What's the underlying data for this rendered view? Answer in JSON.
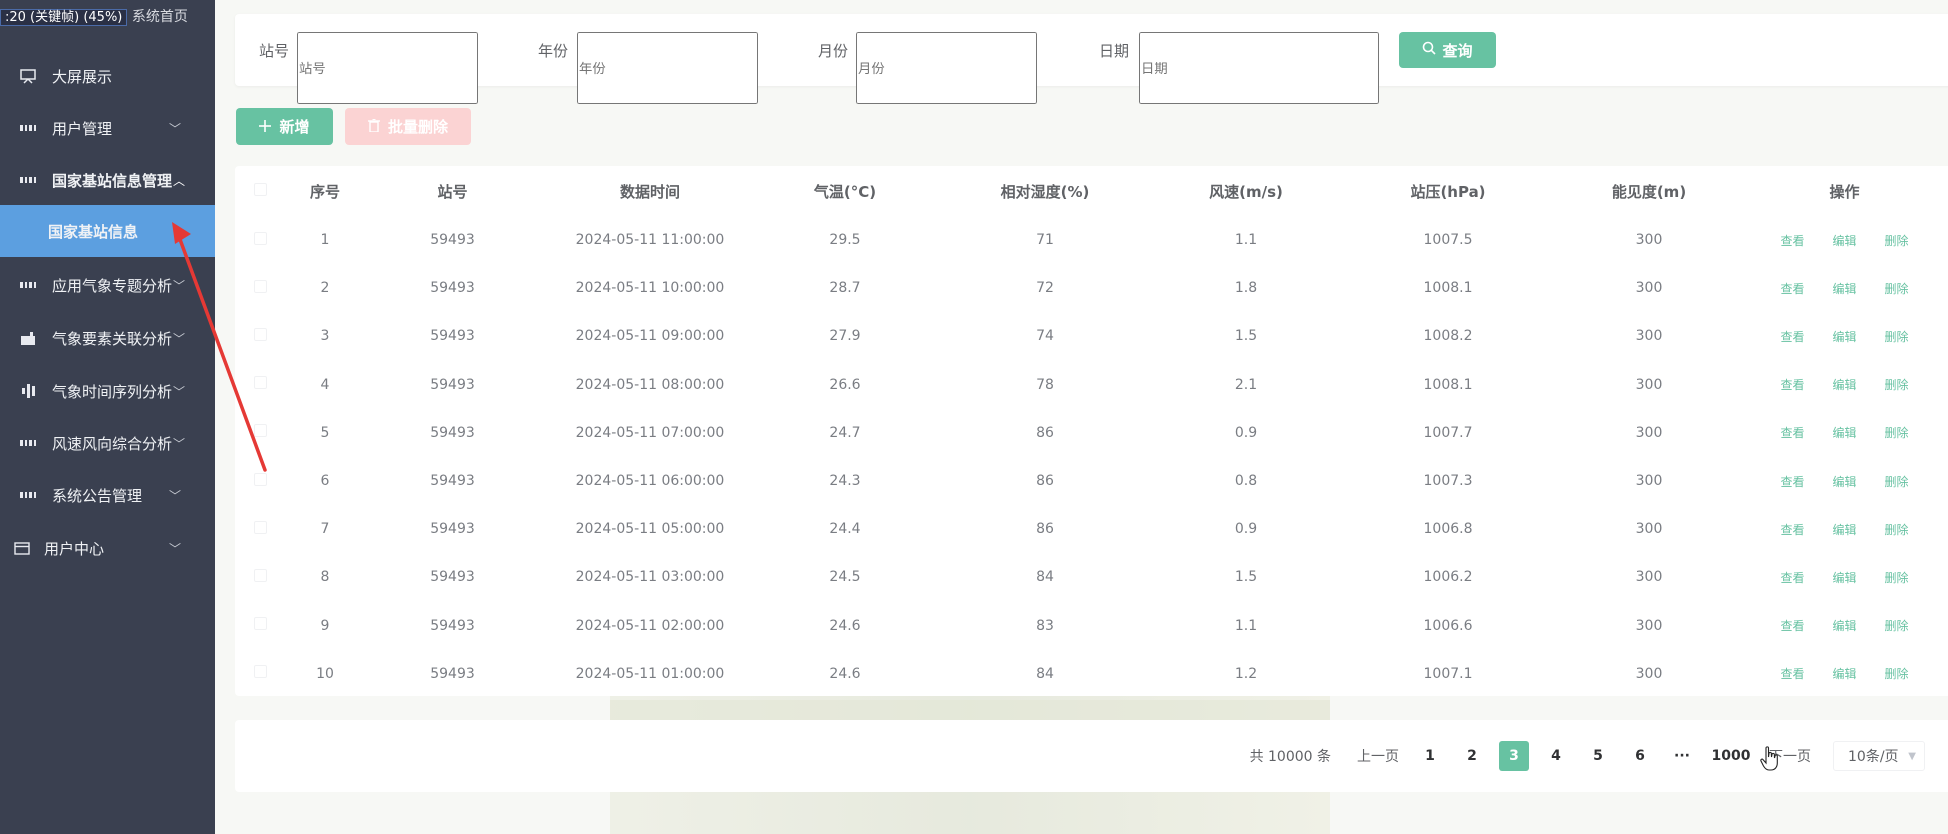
{
  "sidebar": {
    "top_text": "系统首页",
    "time_badge": ":20 (关键帧) (45%)",
    "items": [
      {
        "label": "大屏展示",
        "icon": "screen-icon"
      },
      {
        "label": "用户管理",
        "icon": "grid-icon"
      },
      {
        "label": "国家基站信息管理",
        "icon": "grid-icon"
      },
      {
        "label": "国家基站信息",
        "icon": ""
      },
      {
        "label": "应用气象专题分析",
        "icon": "grid-icon"
      },
      {
        "label": "气象要素关联分析",
        "icon": "factory-icon"
      },
      {
        "label": "气象时间序列分析",
        "icon": "bar-chart-icon"
      },
      {
        "label": "风速风向综合分析",
        "icon": "grid-icon"
      },
      {
        "label": "系统公告管理",
        "icon": "grid-icon"
      },
      {
        "label": "用户中心",
        "icon": "card-icon"
      }
    ],
    "chevron_down": "﹀",
    "chevron_up": "︿"
  },
  "search": {
    "station_label": "站号",
    "station_placeholder": "站号",
    "year_label": "年份",
    "year_placeholder": "年份",
    "month_label": "月份",
    "month_placeholder": "月份",
    "date_label": "日期",
    "date_placeholder": "日期",
    "query_label": "查询"
  },
  "toolbar": {
    "add_label": "新增",
    "batch_delete_label": "批量删除"
  },
  "table": {
    "headers": [
      "序号",
      "站号",
      "数据时间",
      "气温(°C)",
      "相对湿度(%)",
      "风速(m/s)",
      "站压(hPa)",
      "能见度(m)",
      "操作"
    ],
    "ops": {
      "view": "查看",
      "edit": "编辑",
      "delete": "删除"
    },
    "rows": [
      [
        "1",
        "59493",
        "2024-05-11 11:00:00",
        "29.5",
        "71",
        "1.1",
        "1007.5",
        "300"
      ],
      [
        "2",
        "59493",
        "2024-05-11 10:00:00",
        "28.7",
        "72",
        "1.8",
        "1008.1",
        "300"
      ],
      [
        "3",
        "59493",
        "2024-05-11 09:00:00",
        "27.9",
        "74",
        "1.5",
        "1008.2",
        "300"
      ],
      [
        "4",
        "59493",
        "2024-05-11 08:00:00",
        "26.6",
        "78",
        "2.1",
        "1008.1",
        "300"
      ],
      [
        "5",
        "59493",
        "2024-05-11 07:00:00",
        "24.7",
        "86",
        "0.9",
        "1007.7",
        "300"
      ],
      [
        "6",
        "59493",
        "2024-05-11 06:00:00",
        "24.3",
        "86",
        "0.8",
        "1007.3",
        "300"
      ],
      [
        "7",
        "59493",
        "2024-05-11 05:00:00",
        "24.4",
        "86",
        "0.9",
        "1006.8",
        "300"
      ],
      [
        "8",
        "59493",
        "2024-05-11 03:00:00",
        "24.5",
        "84",
        "1.5",
        "1006.2",
        "300"
      ],
      [
        "9",
        "59493",
        "2024-05-11 02:00:00",
        "24.6",
        "83",
        "1.1",
        "1006.6",
        "300"
      ],
      [
        "10",
        "59493",
        "2024-05-11 01:00:00",
        "24.6",
        "84",
        "1.2",
        "1007.1",
        "300"
      ]
    ]
  },
  "pagination": {
    "total": "共 10000 条",
    "prev": "上一页",
    "next": "下一页",
    "pages": [
      "1",
      "2",
      "3",
      "4",
      "5",
      "6",
      "···",
      "1000"
    ],
    "active": "3",
    "page_size": "10条/页"
  },
  "colors": {
    "sidebar_bg": "#3a4050",
    "sidebar_active": "#5c9fe0",
    "accent": "#67c2a2",
    "danger_disabled": "#fbd3d3",
    "arrow": "#e53935"
  }
}
